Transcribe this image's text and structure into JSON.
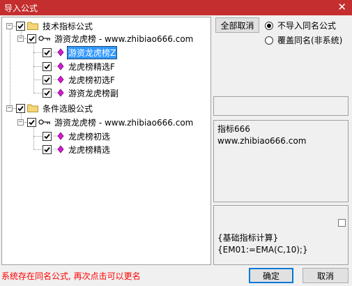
{
  "window": {
    "title": "导入公式",
    "close_glyph": "✕"
  },
  "tree": {
    "group1": {
      "label": "技术指标公式",
      "author": "游资龙虎榜 - www.zhibiao666.com",
      "items": [
        "游资龙虎榜Z",
        "龙虎榜精选F",
        "龙虎榜初选F",
        "游资龙虎榜副"
      ]
    },
    "group2": {
      "label": "条件选股公式",
      "author": "游资龙虎榜 - www.zhibiao666.com",
      "items": [
        "龙虎榜初选",
        "龙虎榜精选"
      ]
    },
    "expand_glyph": "−"
  },
  "controls": {
    "deselect_all": "全部取消",
    "option_skip": "不导入同名公式",
    "option_overwrite": "覆盖同名(非系统)"
  },
  "info": {
    "line1": "指标666",
    "line2": "www.zhibiao666.com"
  },
  "code": {
    "line1": "{基础指标计算}",
    "line2": "{EM01:=EMA(C,10);}"
  },
  "status": "系统存在同名公式, 再次点击可以更名",
  "footer": {
    "ok": "确定",
    "cancel": "取消"
  },
  "colors": {
    "titlebar": "#c42e2e",
    "selection": "#3399ff",
    "status": "#ff0000",
    "folder": "#f5d57a",
    "formula": "#d21bd2"
  }
}
